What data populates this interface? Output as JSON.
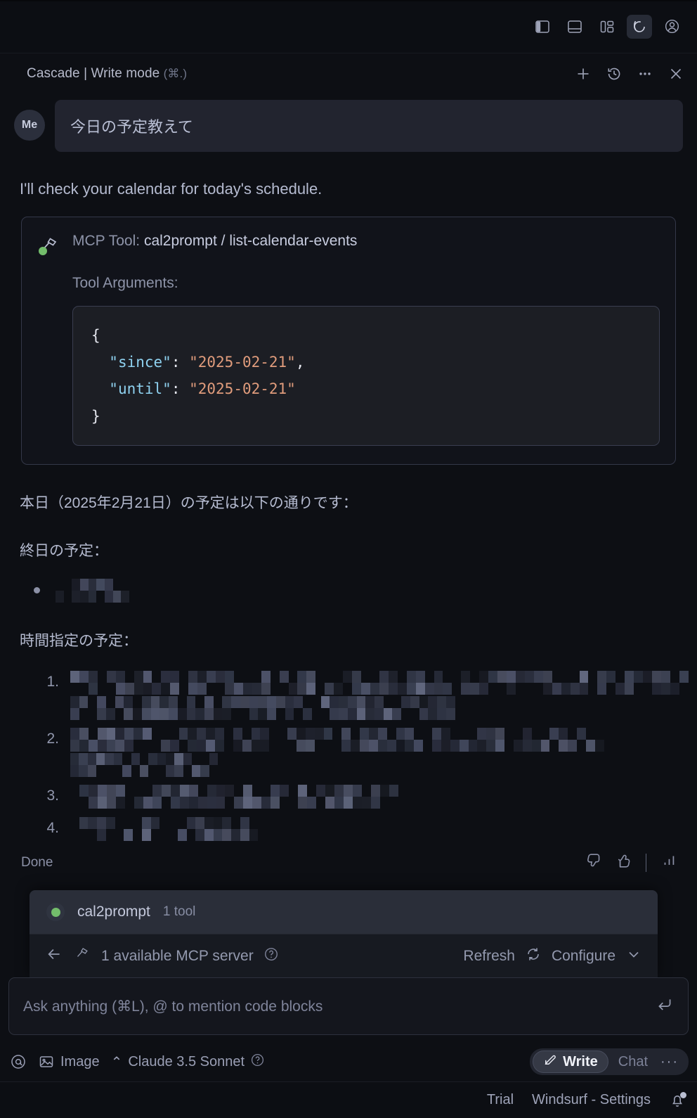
{
  "titlebar": {
    "icons": [
      {
        "name": "toggle-primary-sidebar-icon",
        "label": "Toggle Primary Side Bar"
      },
      {
        "name": "toggle-panel-icon",
        "label": "Toggle Panel"
      },
      {
        "name": "customize-layout-icon",
        "label": "Customize Layout"
      },
      {
        "name": "cascade-logo-icon",
        "label": "Cascade"
      },
      {
        "name": "account-icon",
        "label": "Accounts"
      }
    ]
  },
  "header": {
    "title": "Cascade | Write mode",
    "shortcut": "(⌘.)",
    "actions": [
      {
        "name": "new-conversation-button",
        "label": "New conversation"
      },
      {
        "name": "history-button",
        "label": "History"
      },
      {
        "name": "more-options-button",
        "label": "More"
      },
      {
        "name": "close-button",
        "label": "Close"
      }
    ]
  },
  "conversation": {
    "user": {
      "avatar_label": "Me",
      "message": "今日の予定教えて"
    },
    "assistant_intro": "I'll check your calendar for today's schedule.",
    "tool_call": {
      "prefix": "MCP Tool: ",
      "name": "cal2prompt / list-calendar-events",
      "args_label": "Tool Arguments:",
      "code": {
        "line1": "{",
        "key_since": "\"since\"",
        "val_since": "\"2025-02-21\"",
        "key_until": "\"until\"",
        "val_until": "\"2025-02-21\"",
        "colon": ": ",
        "comma": ",",
        "line_end": "}"
      }
    },
    "summary_intro": "本日（2025年2月21日）の予定は以下の通りです：",
    "allday_heading": "終日の予定：",
    "allday_items": [
      {
        "redacted": true,
        "blocks": 4
      }
    ],
    "timed_heading": "時間指定の予定：",
    "timed_items": [
      {
        "redacted": true,
        "lines": 2
      },
      {
        "redacted": true,
        "lines": 2
      },
      {
        "redacted": true,
        "lines": 1
      },
      {
        "redacted": true,
        "lines": 1
      }
    ],
    "status": "Done",
    "feedback": [
      {
        "name": "thumbs-down-icon",
        "label": "Thumbs down"
      },
      {
        "name": "thumbs-up-icon",
        "label": "Thumbs up"
      },
      {
        "name": "metrics-icon",
        "label": "Metrics"
      }
    ]
  },
  "mcp_popover": {
    "server_name": "cal2prompt",
    "tool_count": "1 tool",
    "status_color": "#73bd6b",
    "back_label": "Back",
    "available_label": "1 available MCP server",
    "help_label": "?",
    "refresh_label": "Refresh",
    "configure_label": "Configure"
  },
  "input": {
    "placeholder": "Ask anything (⌘L), @ to mention code blocks",
    "value": "",
    "submit_label": "Send"
  },
  "bottom_bar": {
    "mention_label": "@",
    "image_label": "Image",
    "model_label": "Claude 3.5 Sonnet",
    "model_chevron": "⌃",
    "model_help": "?",
    "mode_write": "Write",
    "mode_chat": "Chat",
    "mode_more": "···"
  },
  "status_bar": {
    "plan": "Trial",
    "settings": "Windsurf - Settings",
    "notification": "Notifications"
  },
  "colors": {
    "background": "#0d0f14",
    "panel": "#11131a",
    "code_bg": "#1c1e24",
    "accent_green": "#73bd6b",
    "text_primary": "#b5bbd0",
    "text_muted": "#8b90a6",
    "json_key": "#8fd2f0",
    "json_string": "#e09c7c"
  }
}
